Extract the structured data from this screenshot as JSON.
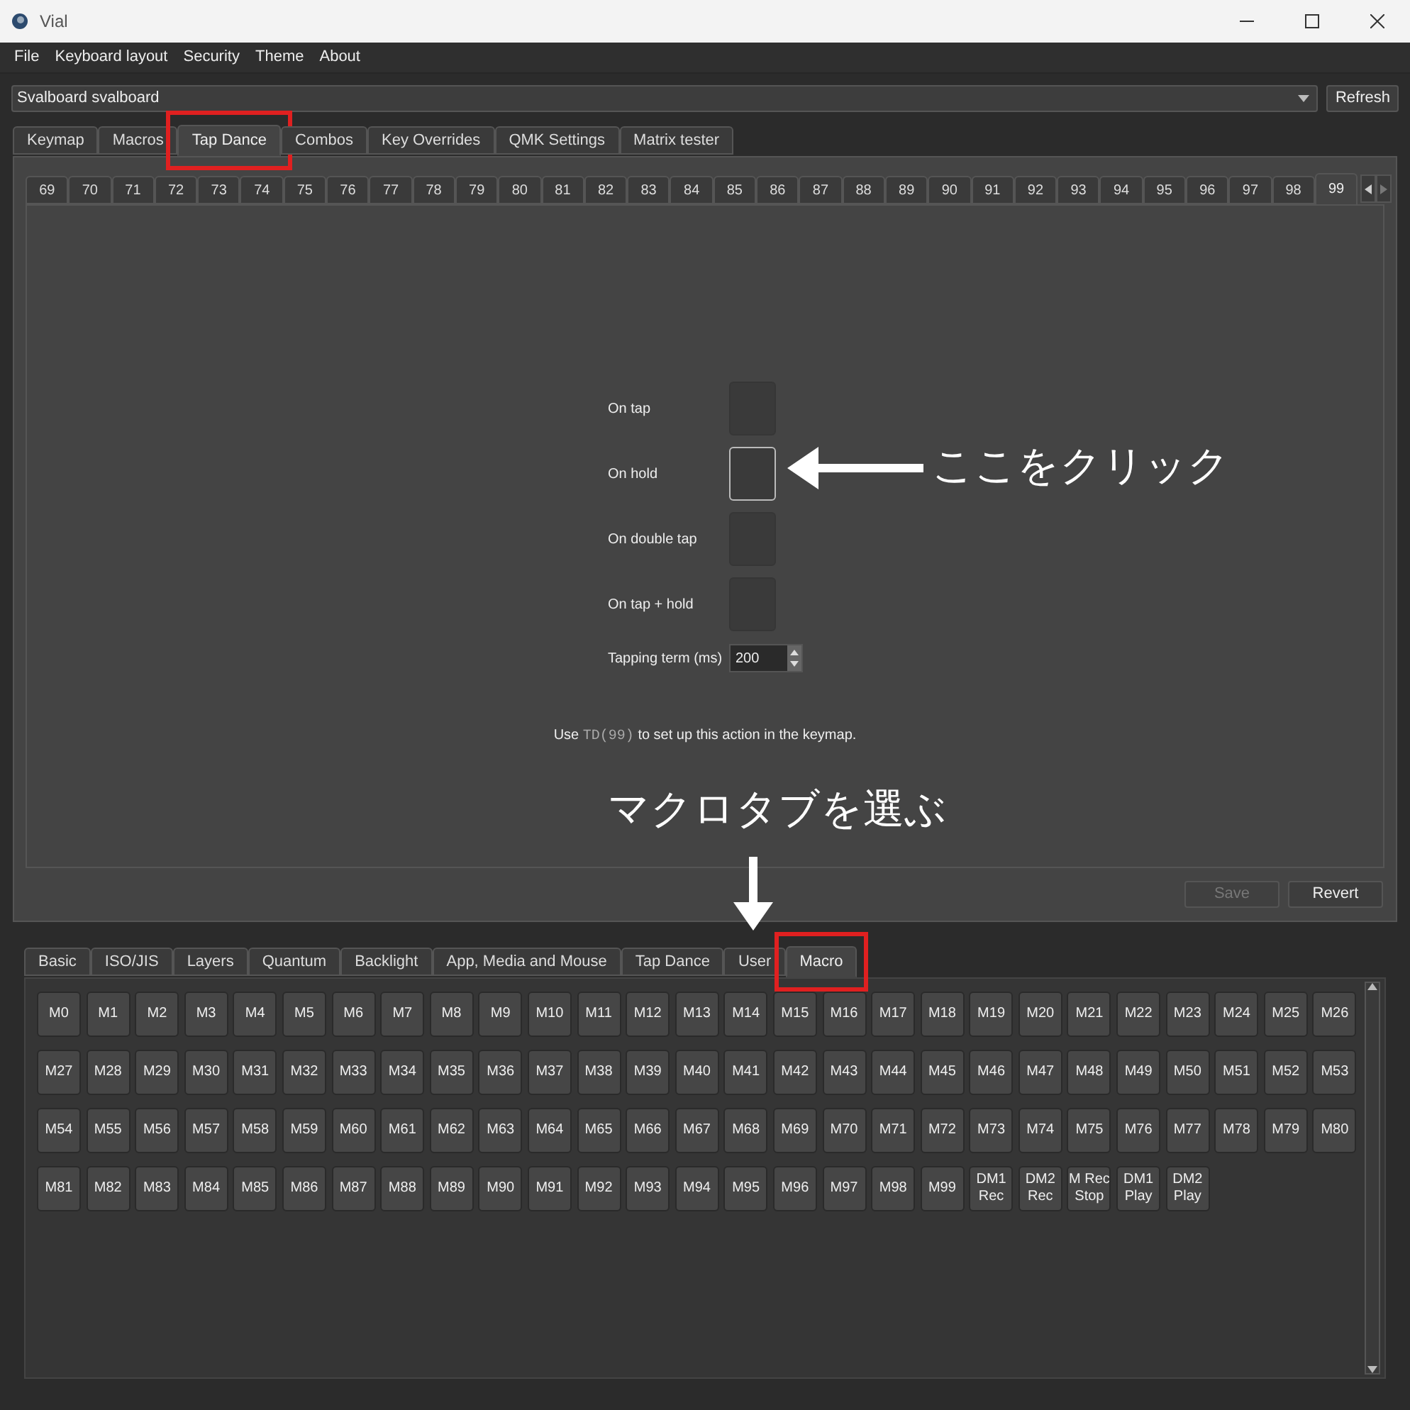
{
  "window": {
    "title": "Vial"
  },
  "menu": [
    "File",
    "Keyboard layout",
    "Security",
    "Theme",
    "About"
  ],
  "device": {
    "value": "Svalboard svalboard"
  },
  "refresh_button": "Refresh",
  "main_tabs": [
    {
      "label": "Keymap",
      "selected": false,
      "annotated": false
    },
    {
      "label": "Macros",
      "selected": false,
      "annotated": false
    },
    {
      "label": "Tap Dance",
      "selected": true,
      "annotated": true
    },
    {
      "label": "Combos",
      "selected": false,
      "annotated": false
    },
    {
      "label": "Key Overrides",
      "selected": false,
      "annotated": false
    },
    {
      "label": "QMK Settings",
      "selected": false,
      "annotated": false
    },
    {
      "label": "Matrix tester",
      "selected": false,
      "annotated": false
    }
  ],
  "tap_dance_tabs": [
    {
      "label": "69",
      "selected": false
    },
    {
      "label": "70",
      "selected": false
    },
    {
      "label": "71",
      "selected": false
    },
    {
      "label": "72",
      "selected": false
    },
    {
      "label": "73",
      "selected": false
    },
    {
      "label": "74",
      "selected": false
    },
    {
      "label": "75",
      "selected": false
    },
    {
      "label": "76",
      "selected": false
    },
    {
      "label": "77",
      "selected": false
    },
    {
      "label": "78",
      "selected": false
    },
    {
      "label": "79",
      "selected": false
    },
    {
      "label": "80",
      "selected": false
    },
    {
      "label": "81",
      "selected": false
    },
    {
      "label": "82",
      "selected": false
    },
    {
      "label": "83",
      "selected": false
    },
    {
      "label": "84",
      "selected": false
    },
    {
      "label": "85",
      "selected": false
    },
    {
      "label": "86",
      "selected": false
    },
    {
      "label": "87",
      "selected": false
    },
    {
      "label": "88",
      "selected": false
    },
    {
      "label": "89",
      "selected": false
    },
    {
      "label": "90",
      "selected": false
    },
    {
      "label": "91",
      "selected": false
    },
    {
      "label": "92",
      "selected": false
    },
    {
      "label": "93",
      "selected": false
    },
    {
      "label": "94",
      "selected": false
    },
    {
      "label": "95",
      "selected": false
    },
    {
      "label": "96",
      "selected": false
    },
    {
      "label": "97",
      "selected": false
    },
    {
      "label": "98",
      "selected": false
    },
    {
      "label": "99",
      "selected": true
    }
  ],
  "actions": [
    {
      "label": "On tap",
      "selected": false
    },
    {
      "label": "On hold",
      "selected": true
    },
    {
      "label": "On double tap",
      "selected": false
    },
    {
      "label": "On tap + hold",
      "selected": false
    }
  ],
  "tapping_term": {
    "label": "Tapping term (ms)",
    "value": "200"
  },
  "hint": {
    "before": "Use",
    "code": "TD(99)",
    "after": "to set up this action in the keymap."
  },
  "save_button": {
    "label": "Save",
    "disabled": true
  },
  "revert_button": {
    "label": "Revert",
    "disabled": false
  },
  "key_tabs": [
    {
      "label": "Basic",
      "selected": false,
      "annotated": false
    },
    {
      "label": "ISO/JIS",
      "selected": false,
      "annotated": false
    },
    {
      "label": "Layers",
      "selected": false,
      "annotated": false
    },
    {
      "label": "Quantum",
      "selected": false,
      "annotated": false
    },
    {
      "label": "Backlight",
      "selected": false,
      "annotated": false
    },
    {
      "label": "App, Media and Mouse",
      "selected": false,
      "annotated": false
    },
    {
      "label": "Tap Dance",
      "selected": false,
      "annotated": false
    },
    {
      "label": "User",
      "selected": false,
      "annotated": false
    },
    {
      "label": "Macro",
      "selected": true,
      "annotated": true
    }
  ],
  "macro_keys": [
    {
      "lines": [
        "M0"
      ]
    },
    {
      "lines": [
        "M1"
      ]
    },
    {
      "lines": [
        "M2"
      ]
    },
    {
      "lines": [
        "M3"
      ]
    },
    {
      "lines": [
        "M4"
      ]
    },
    {
      "lines": [
        "M5"
      ]
    },
    {
      "lines": [
        "M6"
      ]
    },
    {
      "lines": [
        "M7"
      ]
    },
    {
      "lines": [
        "M8"
      ]
    },
    {
      "lines": [
        "M9"
      ]
    },
    {
      "lines": [
        "M10"
      ]
    },
    {
      "lines": [
        "M11"
      ]
    },
    {
      "lines": [
        "M12"
      ]
    },
    {
      "lines": [
        "M13"
      ]
    },
    {
      "lines": [
        "M14"
      ]
    },
    {
      "lines": [
        "M15"
      ]
    },
    {
      "lines": [
        "M16"
      ]
    },
    {
      "lines": [
        "M17"
      ]
    },
    {
      "lines": [
        "M18"
      ]
    },
    {
      "lines": [
        "M19"
      ]
    },
    {
      "lines": [
        "M20"
      ]
    },
    {
      "lines": [
        "M21"
      ]
    },
    {
      "lines": [
        "M22"
      ]
    },
    {
      "lines": [
        "M23"
      ]
    },
    {
      "lines": [
        "M24"
      ]
    },
    {
      "lines": [
        "M25"
      ]
    },
    {
      "lines": [
        "M26"
      ]
    },
    {
      "lines": [
        "M27"
      ]
    },
    {
      "lines": [
        "M28"
      ]
    },
    {
      "lines": [
        "M29"
      ]
    },
    {
      "lines": [
        "M30"
      ]
    },
    {
      "lines": [
        "M31"
      ]
    },
    {
      "lines": [
        "M32"
      ]
    },
    {
      "lines": [
        "M33"
      ]
    },
    {
      "lines": [
        "M34"
      ]
    },
    {
      "lines": [
        "M35"
      ]
    },
    {
      "lines": [
        "M36"
      ]
    },
    {
      "lines": [
        "M37"
      ]
    },
    {
      "lines": [
        "M38"
      ]
    },
    {
      "lines": [
        "M39"
      ]
    },
    {
      "lines": [
        "M40"
      ]
    },
    {
      "lines": [
        "M41"
      ]
    },
    {
      "lines": [
        "M42"
      ]
    },
    {
      "lines": [
        "M43"
      ]
    },
    {
      "lines": [
        "M44"
      ]
    },
    {
      "lines": [
        "M45"
      ]
    },
    {
      "lines": [
        "M46"
      ]
    },
    {
      "lines": [
        "M47"
      ]
    },
    {
      "lines": [
        "M48"
      ]
    },
    {
      "lines": [
        "M49"
      ]
    },
    {
      "lines": [
        "M50"
      ]
    },
    {
      "lines": [
        "M51"
      ]
    },
    {
      "lines": [
        "M52"
      ]
    },
    {
      "lines": [
        "M53"
      ]
    },
    {
      "lines": [
        "M54"
      ]
    },
    {
      "lines": [
        "M55"
      ]
    },
    {
      "lines": [
        "M56"
      ]
    },
    {
      "lines": [
        "M57"
      ]
    },
    {
      "lines": [
        "M58"
      ]
    },
    {
      "lines": [
        "M59"
      ]
    },
    {
      "lines": [
        "M60"
      ]
    },
    {
      "lines": [
        "M61"
      ]
    },
    {
      "lines": [
        "M62"
      ]
    },
    {
      "lines": [
        "M63"
      ]
    },
    {
      "lines": [
        "M64"
      ]
    },
    {
      "lines": [
        "M65"
      ]
    },
    {
      "lines": [
        "M66"
      ]
    },
    {
      "lines": [
        "M67"
      ]
    },
    {
      "lines": [
        "M68"
      ]
    },
    {
      "lines": [
        "M69"
      ]
    },
    {
      "lines": [
        "M70"
      ]
    },
    {
      "lines": [
        "M71"
      ]
    },
    {
      "lines": [
        "M72"
      ]
    },
    {
      "lines": [
        "M73"
      ]
    },
    {
      "lines": [
        "M74"
      ]
    },
    {
      "lines": [
        "M75"
      ]
    },
    {
      "lines": [
        "M76"
      ]
    },
    {
      "lines": [
        "M77"
      ]
    },
    {
      "lines": [
        "M78"
      ]
    },
    {
      "lines": [
        "M79"
      ]
    },
    {
      "lines": [
        "M80"
      ]
    },
    {
      "lines": [
        "M81"
      ]
    },
    {
      "lines": [
        "M82"
      ]
    },
    {
      "lines": [
        "M83"
      ]
    },
    {
      "lines": [
        "M84"
      ]
    },
    {
      "lines": [
        "M85"
      ]
    },
    {
      "lines": [
        "M86"
      ]
    },
    {
      "lines": [
        "M87"
      ]
    },
    {
      "lines": [
        "M88"
      ]
    },
    {
      "lines": [
        "M89"
      ]
    },
    {
      "lines": [
        "M90"
      ]
    },
    {
      "lines": [
        "M91"
      ]
    },
    {
      "lines": [
        "M92"
      ]
    },
    {
      "lines": [
        "M93"
      ]
    },
    {
      "lines": [
        "M94"
      ]
    },
    {
      "lines": [
        "M95"
      ]
    },
    {
      "lines": [
        "M96"
      ]
    },
    {
      "lines": [
        "M97"
      ]
    },
    {
      "lines": [
        "M98"
      ]
    },
    {
      "lines": [
        "M99"
      ]
    },
    {
      "lines": [
        "DM1",
        "Rec"
      ]
    },
    {
      "lines": [
        "DM2",
        "Rec"
      ]
    },
    {
      "lines": [
        "M Rec",
        "Stop"
      ]
    },
    {
      "lines": [
        "DM1",
        "Play"
      ]
    },
    {
      "lines": [
        "DM2",
        "Play"
      ]
    }
  ],
  "annotations": [
    {
      "kind": "left",
      "text": "ここをクリック"
    },
    {
      "kind": "down",
      "text": "マクロタブを選ぶ"
    }
  ]
}
